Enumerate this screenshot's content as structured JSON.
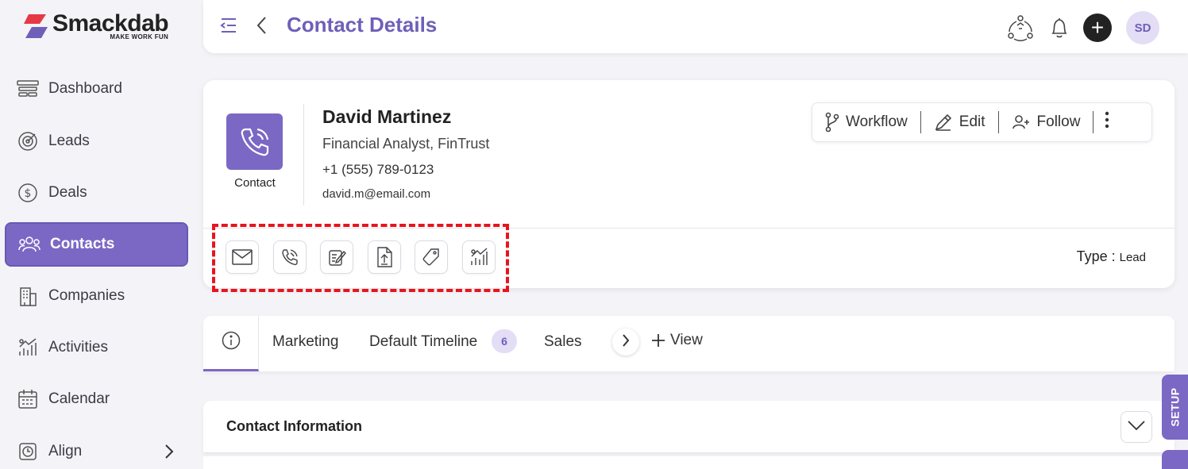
{
  "brand": {
    "name": "Smackdab",
    "tagline": "MAKE WORK FUN"
  },
  "sidebar": {
    "items": [
      {
        "label": "Dashboard",
        "icon": "dashboard-icon"
      },
      {
        "label": "Leads",
        "icon": "target-icon"
      },
      {
        "label": "Deals",
        "icon": "dollar-icon"
      },
      {
        "label": "Contacts",
        "icon": "people-icon",
        "active": true
      },
      {
        "label": "Companies",
        "icon": "building-icon"
      },
      {
        "label": "Activities",
        "icon": "activity-chart-icon"
      },
      {
        "label": "Calendar",
        "icon": "calendar-icon"
      },
      {
        "label": "Align",
        "icon": "clock-icon"
      }
    ]
  },
  "header": {
    "title": "Contact Details",
    "avatar_initials": "SD"
  },
  "contact": {
    "type_label": "Contact",
    "name": "David Martinez",
    "role": "Financial Analyst, FinTrust",
    "phone": "+1 (555) 789-0123",
    "email": "david.m@email.com"
  },
  "actions": {
    "workflow": "Workflow",
    "edit": "Edit",
    "follow": "Follow"
  },
  "quick_actions": [
    "email-icon",
    "phone-icon",
    "note-icon",
    "upload-icon",
    "tag-icon",
    "activity-icon"
  ],
  "type": {
    "label": "Type :",
    "value": "Lead"
  },
  "tabs": {
    "marketing": "Marketing",
    "timeline": "Default Timeline",
    "timeline_count": "6",
    "sales": "Sales",
    "view": "View"
  },
  "section": {
    "title": "Contact Information"
  },
  "setup_label": "SETUP",
  "colors": {
    "accent": "#7b68c4",
    "highlight": "#e8141c"
  }
}
